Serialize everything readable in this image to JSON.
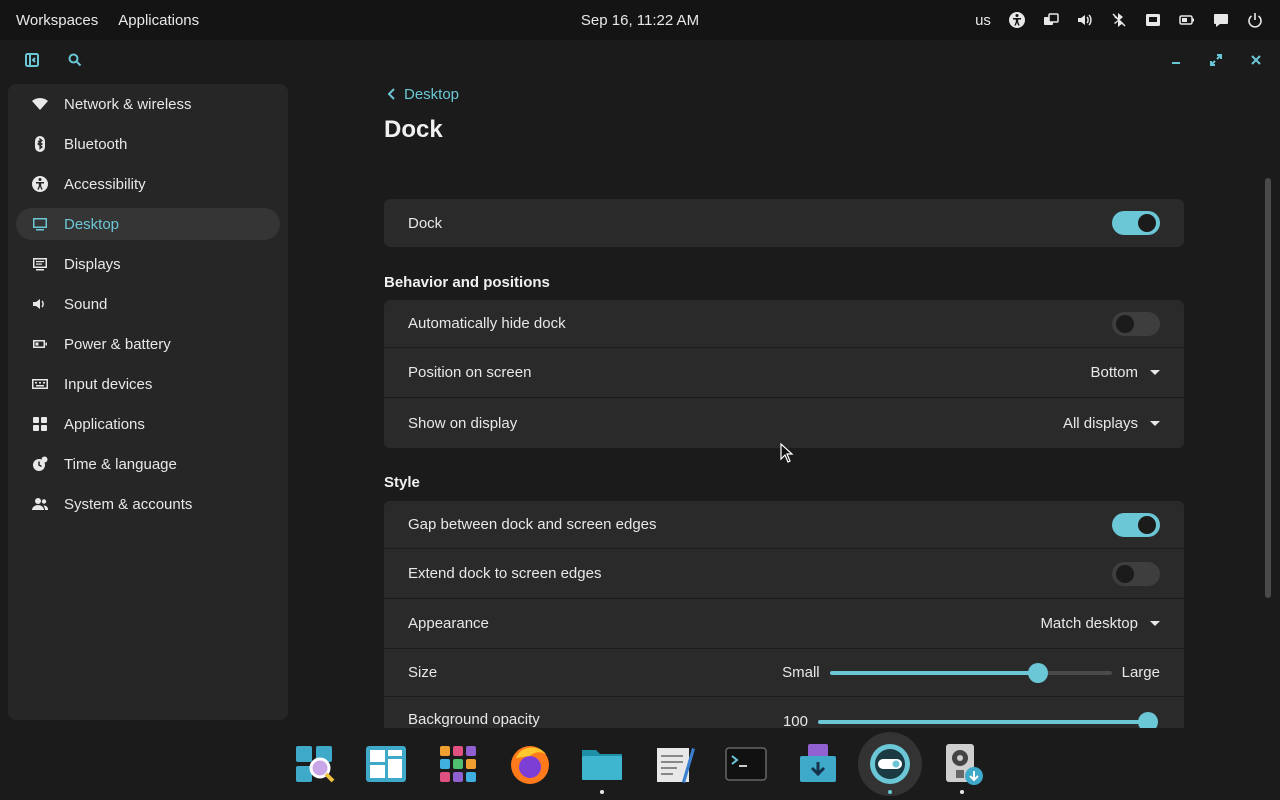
{
  "top_panel": {
    "workspaces": "Workspaces",
    "applications": "Applications",
    "clock": "Sep 16, 11:22 AM",
    "keyboard_layout": "us"
  },
  "sidebar": {
    "items": [
      {
        "label": "Network & wireless",
        "icon": "wifi-icon"
      },
      {
        "label": "Bluetooth",
        "icon": "bluetooth-icon"
      },
      {
        "label": "Accessibility",
        "icon": "accessibility-icon"
      },
      {
        "label": "Desktop",
        "icon": "monitor-icon",
        "active": true
      },
      {
        "label": "Displays",
        "icon": "displays-icon"
      },
      {
        "label": "Sound",
        "icon": "speaker-icon"
      },
      {
        "label": "Power & battery",
        "icon": "battery-icon"
      },
      {
        "label": "Input devices",
        "icon": "keyboard-icon"
      },
      {
        "label": "Applications",
        "icon": "apps-grid-icon"
      },
      {
        "label": "Time & language",
        "icon": "time-language-icon"
      },
      {
        "label": "System & accounts",
        "icon": "users-icon"
      }
    ]
  },
  "content": {
    "breadcrumb": "Desktop",
    "title": "Dock",
    "dock_toggle": {
      "label": "Dock",
      "on": true
    },
    "behavior": {
      "heading": "Behavior and positions",
      "auto_hide": {
        "label": "Automatically hide dock",
        "on": false
      },
      "position": {
        "label": "Position on screen",
        "value": "Bottom"
      },
      "show_on": {
        "label": "Show on display",
        "value": "All displays"
      }
    },
    "style": {
      "heading": "Style",
      "gap": {
        "label": "Gap between dock and screen edges",
        "on": true
      },
      "extend": {
        "label": "Extend dock to screen edges",
        "on": false
      },
      "appearance": {
        "label": "Appearance",
        "value": "Match desktop"
      },
      "size": {
        "label": "Size",
        "min_label": "Small",
        "max_label": "Large",
        "fraction": 0.74
      },
      "opacity": {
        "label": "Background opacity",
        "value_label": "100",
        "fraction": 1.0
      }
    }
  },
  "dock": {
    "apps": [
      "app-library-icon",
      "workspaces-overview-icon",
      "launcher-grid-icon",
      "firefox-icon",
      "files-icon",
      "text-editor-icon",
      "terminal-icon",
      "store-icon",
      "settings-icon",
      "installer-icon"
    ],
    "running": [
      false,
      false,
      false,
      false,
      true,
      false,
      false,
      false,
      true,
      true
    ],
    "focused": "settings-icon"
  },
  "colors": {
    "accent": "#6bc6d6",
    "background": "#1b1b1b",
    "card": "#2a2a2a"
  }
}
